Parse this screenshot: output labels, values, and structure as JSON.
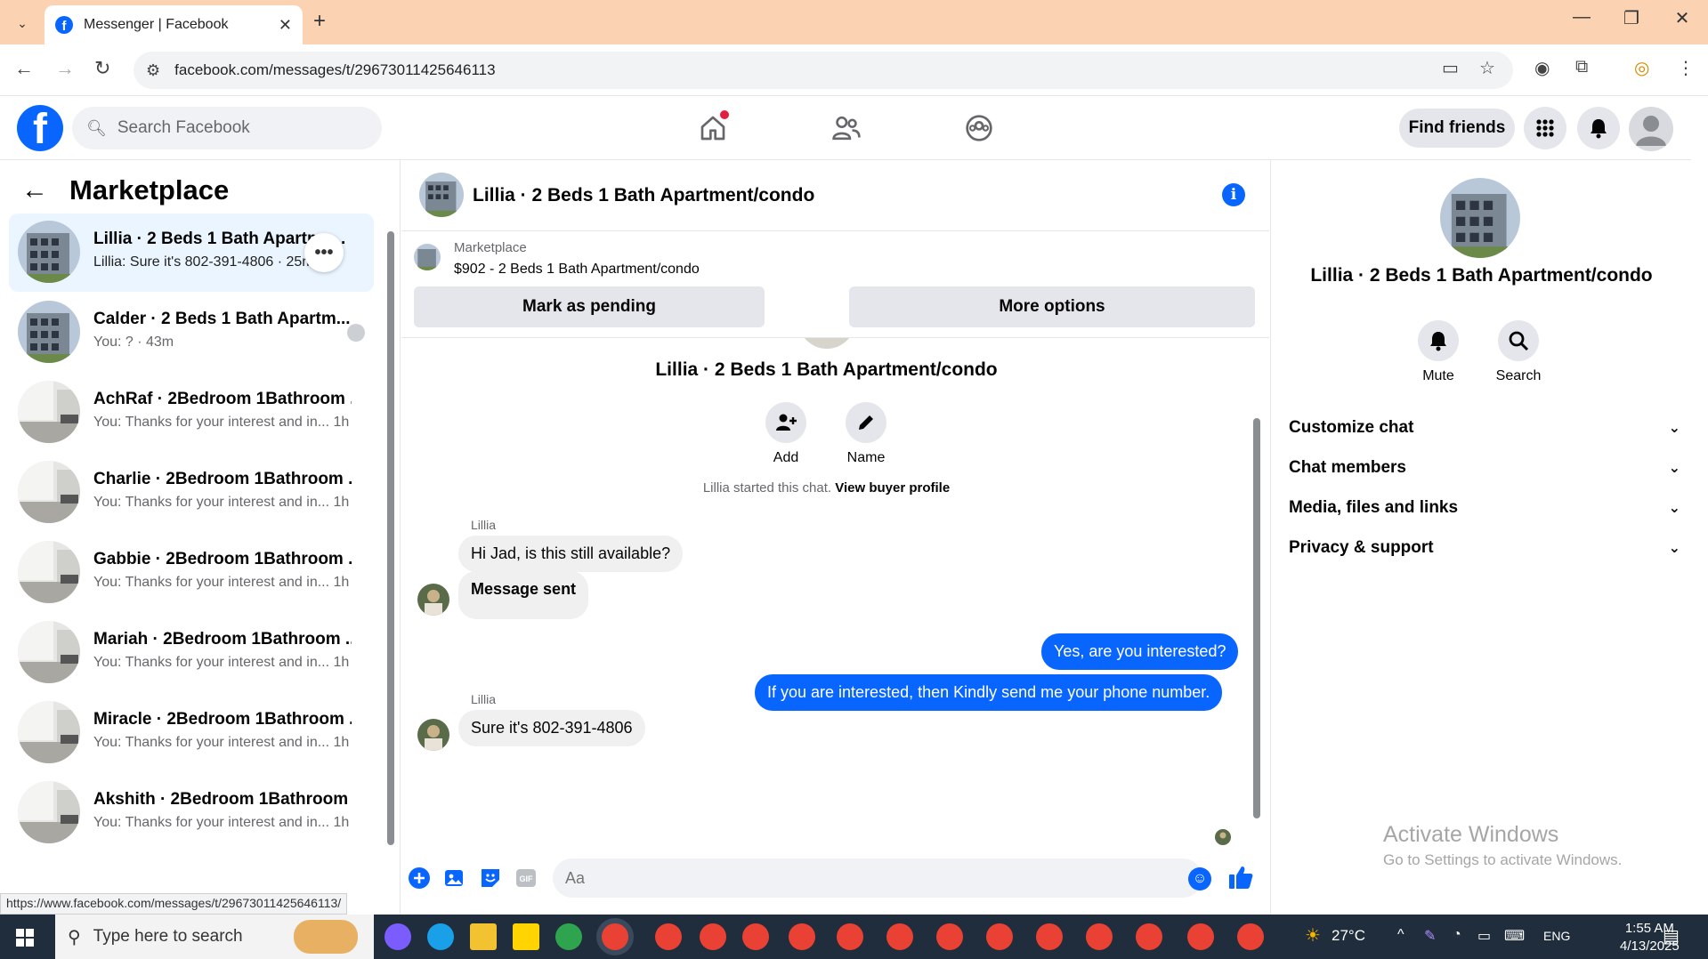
{
  "browser": {
    "tab_title": "Messenger | Facebook",
    "url": "facebook.com/messages/t/29673011425646113",
    "status_url": "https://www.facebook.com/messages/t/29673011425646113/"
  },
  "fb": {
    "search_placeholder": "Search Facebook",
    "find_friends": "Find friends"
  },
  "left": {
    "title": "Marketplace",
    "conversations": [
      {
        "name": "Lillia · 2 Beds 1 Bath Apartme...",
        "sub": "Lillia: Sure it's 802-391-4806 · 25m"
      },
      {
        "name": "Calder · 2 Beds 1 Bath Apartm...",
        "sub": "You: ? · 43m"
      },
      {
        "name": "AchRaf · 2Bedroom 1Bathroom ...",
        "sub": "You: Thanks for your interest and in...  1h"
      },
      {
        "name": "Charlie · 2Bedroom 1Bathroom ...",
        "sub": "You: Thanks for your interest and in...  1h"
      },
      {
        "name": "Gabbie · 2Bedroom 1Bathroom ...",
        "sub": "You: Thanks for your interest and in...  1h"
      },
      {
        "name": "Mariah · 2Bedroom 1Bathroom ...",
        "sub": "You: Thanks for your interest and in...  1h"
      },
      {
        "name": "Miracle · 2Bedroom 1Bathroom ...",
        "sub": "You: Thanks for your interest and in...  1h"
      },
      {
        "name": "Akshith · 2Bedroom 1Bathroom ...",
        "sub": "You: Thanks for your interest and in...  1h"
      }
    ]
  },
  "chat": {
    "title": "Lillia · 2 Beds 1 Bath Apartment/condo",
    "marketplace_label": "Marketplace",
    "listing": "$902 - 2 Beds 1 Bath Apartment/condo",
    "mark_pending": "Mark as pending",
    "more_options": "More options",
    "thread_title": "Lillia · 2 Beds 1 Bath Apartment/condo",
    "add_label": "Add",
    "name_label": "Name",
    "started_text": "Lillia started this chat.",
    "view_profile": "View buyer profile",
    "sender": "Lillia",
    "msg1": "Hi Jad, is this still available?",
    "msg2": "Message sent",
    "msg3": "Yes, are you interested?",
    "msg4": "If you are interested, then Kindly send me your phone number.",
    "msg5": "Sure it's 802-391-4806",
    "composer_placeholder": "Aa"
  },
  "right": {
    "name": "Lillia · 2 Beds 1 Bath Apartment/condo",
    "mute": "Mute",
    "search": "Search",
    "sections": [
      "Customize chat",
      "Chat members",
      "Media, files and links",
      "Privacy & support"
    ],
    "activate_title": "Activate Windows",
    "activate_sub": "Go to Settings to activate Windows."
  },
  "taskbar": {
    "search_placeholder": "Type here to search",
    "temp": "27°C",
    "lang": "ENG",
    "time": "1:55 AM",
    "date": "4/13/2025"
  },
  "colors": {
    "fb_blue": "#0866ff",
    "tabbar": "#fbd3b2",
    "taskbar": "#1f2d3d"
  }
}
